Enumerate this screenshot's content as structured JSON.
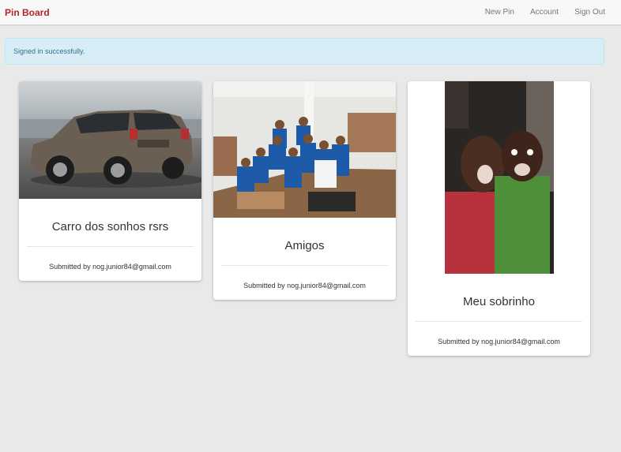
{
  "nav": {
    "brand": "Pin Board",
    "links": [
      "New Pin",
      "Account",
      "Sign Out"
    ]
  },
  "alert": {
    "text": "Signed in successfully."
  },
  "pins": [
    {
      "title": "Carro dos sonhos rsrs",
      "submitted": "Submitted by nog.junior84@gmail.com"
    },
    {
      "title": "Amigos",
      "submitted": "Submitted by nog.junior84@gmail.com"
    },
    {
      "title": "Meu sobrinho",
      "submitted": "Submitted by nog.junior84@gmail.com"
    }
  ],
  "colors": {
    "brand": "#b5262c",
    "alert_bg": "#d9edf7",
    "alert_text": "#31708f"
  }
}
